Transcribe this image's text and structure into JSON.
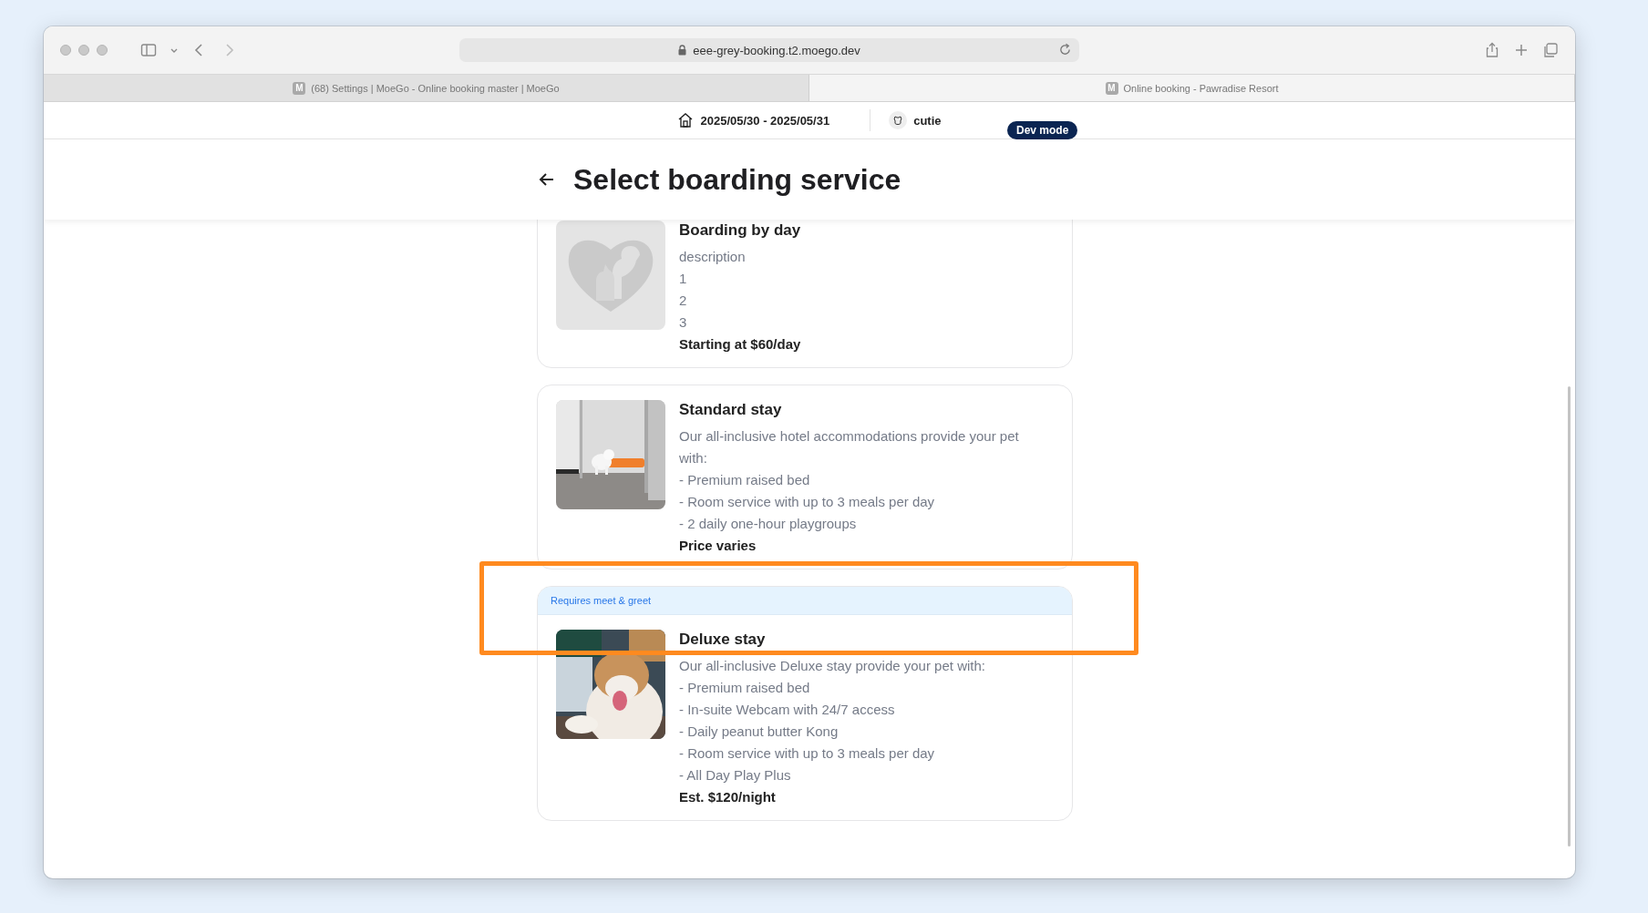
{
  "browser": {
    "url": "eee-grey-booking.t2.moego.dev",
    "tabs": [
      {
        "favicon": "M",
        "label": "(68) Settings | MoeGo - Online booking master | MoeGo",
        "selected": false
      },
      {
        "favicon": "M",
        "label": "Online booking - Pawradise Resort",
        "selected": true
      }
    ]
  },
  "header": {
    "dates": "2025/05/30 - 2025/05/31",
    "pet": "cutie",
    "badge": "Dev mode"
  },
  "page": {
    "title": "Select boarding service"
  },
  "services": [
    {
      "name": "Boarding by day",
      "kind": "placeholder",
      "lines": [
        "description",
        "1",
        "2",
        "3"
      ],
      "price": "Starting at $60/day"
    },
    {
      "name": "Standard stay",
      "kind": "picture",
      "lines": [
        "Our all-inclusive hotel accommodations provide your pet with:",
        "- Premium raised bed",
        "- Room service with up to 3 meals per day",
        "- 2 daily one-hour playgroups"
      ],
      "price": "Price varies"
    },
    {
      "tag": "Requires meet & greet",
      "name": "Deluxe stay",
      "kind": "picture",
      "lines": [
        "Our all-inclusive Deluxe stay provide your pet with:",
        "- Premium raised bed",
        "- In-suite Webcam with 24/7 access",
        "- Daily peanut butter Kong",
        "- Room service with up to 3 meals per day",
        "- All Day Play Plus"
      ],
      "price": "Est. $120/night"
    }
  ]
}
